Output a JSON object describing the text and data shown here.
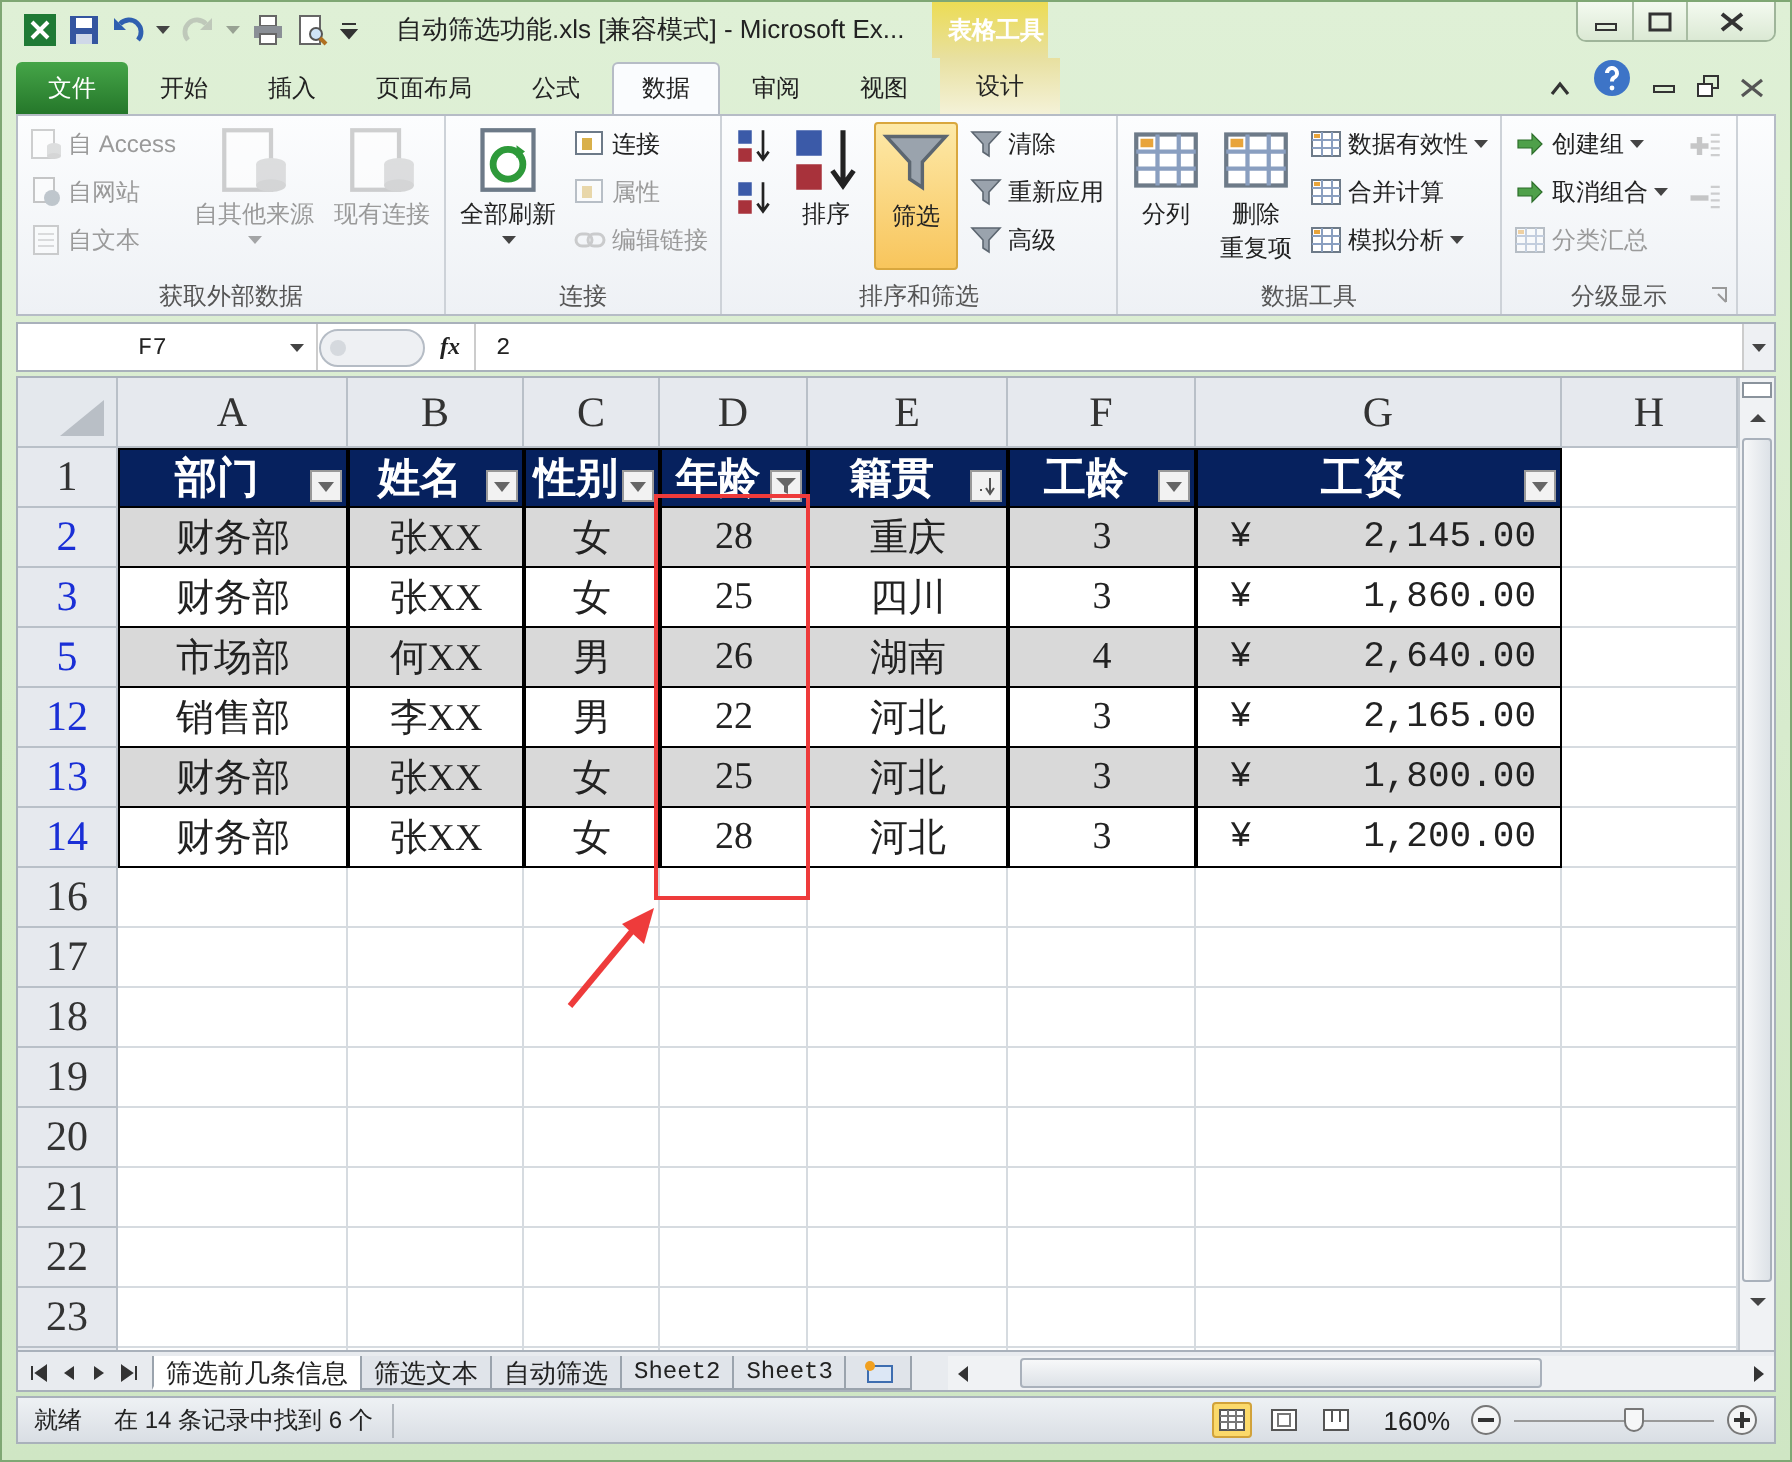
{
  "window": {
    "title": "自动筛选功能.xls  [兼容模式] - Microsoft Ex...",
    "context_group": "表格工具"
  },
  "ribbon_tabs": [
    {
      "label": "文件",
      "kind": "file",
      "selected": false
    },
    {
      "label": "开始",
      "kind": "normal",
      "selected": false
    },
    {
      "label": "插入",
      "kind": "normal",
      "selected": false
    },
    {
      "label": "页面布局",
      "kind": "normal",
      "selected": false
    },
    {
      "label": "公式",
      "kind": "normal",
      "selected": false
    },
    {
      "label": "数据",
      "kind": "normal",
      "selected": true
    },
    {
      "label": "审阅",
      "kind": "normal",
      "selected": false
    },
    {
      "label": "视图",
      "kind": "normal",
      "selected": false
    },
    {
      "label": "设计",
      "kind": "context",
      "selected": false
    }
  ],
  "ribbon": {
    "groups": [
      {
        "title": "获取外部数据",
        "columns": [
          {
            "items": [
              {
                "kind": "small",
                "label": "自 Access",
                "disabled": true,
                "dropdown": false,
                "on": false
              },
              {
                "kind": "small",
                "label": "自网站",
                "disabled": true,
                "dropdown": false,
                "on": false
              },
              {
                "kind": "small",
                "label": "自文本",
                "disabled": true,
                "dropdown": false,
                "on": false
              }
            ]
          },
          {
            "items": [
              {
                "kind": "large",
                "label": "自其他来源",
                "disabled": true,
                "dropdown": true,
                "on": false
              }
            ]
          },
          {
            "items": [
              {
                "kind": "large",
                "label": "现有连接",
                "disabled": true,
                "dropdown": false,
                "on": false
              }
            ]
          }
        ]
      },
      {
        "title": "连接",
        "columns": [
          {
            "items": [
              {
                "kind": "large",
                "label": "全部刷新",
                "disabled": false,
                "dropdown": true,
                "on": false
              }
            ]
          },
          {
            "items": [
              {
                "kind": "small",
                "label": "连接",
                "disabled": false,
                "dropdown": false,
                "on": false
              },
              {
                "kind": "small",
                "label": "属性",
                "disabled": true,
                "dropdown": false,
                "on": false
              },
              {
                "kind": "small",
                "label": "编辑链接",
                "disabled": true,
                "dropdown": false,
                "on": false
              }
            ]
          }
        ]
      },
      {
        "title": "排序和筛选",
        "columns": [
          {
            "items": [
              {
                "kind": "icon",
                "disabled": false,
                "dropdown": false,
                "on": false
              },
              {
                "kind": "icon",
                "disabled": false,
                "dropdown": false,
                "on": false
              }
            ]
          },
          {
            "items": [
              {
                "kind": "large",
                "label": "排序",
                "disabled": false,
                "dropdown": false,
                "on": false
              }
            ]
          },
          {
            "items": [
              {
                "kind": "large",
                "label": "筛选",
                "disabled": false,
                "dropdown": false,
                "on": true
              }
            ]
          },
          {
            "items": [
              {
                "kind": "small",
                "label": "清除",
                "disabled": false,
                "dropdown": false,
                "on": false
              },
              {
                "kind": "small",
                "label": "重新应用",
                "disabled": false,
                "dropdown": false,
                "on": false
              },
              {
                "kind": "small",
                "label": "高级",
                "disabled": false,
                "dropdown": false,
                "on": false
              }
            ]
          }
        ]
      },
      {
        "title": "数据工具",
        "columns": [
          {
            "items": [
              {
                "kind": "large",
                "label": "分列",
                "disabled": false,
                "dropdown": false,
                "on": false
              }
            ]
          },
          {
            "items": [
              {
                "kind": "large",
                "label": "删除",
                "label_2": "重复项",
                "disabled": false,
                "dropdown": false,
                "on": false
              }
            ]
          },
          {
            "items": [
              {
                "kind": "small",
                "label": "数据有效性",
                "disabled": false,
                "dropdown": true,
                "on": false
              },
              {
                "kind": "small",
                "label": "合并计算",
                "disabled": false,
                "dropdown": false,
                "on": false
              },
              {
                "kind": "small",
                "label": "模拟分析",
                "disabled": false,
                "dropdown": true,
                "on": false
              }
            ]
          }
        ]
      },
      {
        "title": "分级显示",
        "columns": [
          {
            "items": [
              {
                "kind": "small",
                "label": "创建组",
                "disabled": false,
                "dropdown": true,
                "on": false
              },
              {
                "kind": "small",
                "label": "取消组合",
                "disabled": false,
                "dropdown": true,
                "on": false
              },
              {
                "kind": "small",
                "label": "分类汇总",
                "disabled": true,
                "dropdown": false,
                "on": false
              }
            ]
          },
          {
            "items": [
              {
                "kind": "icon",
                "disabled": true,
                "dropdown": false,
                "on": false
              },
              {
                "kind": "icon",
                "disabled": true,
                "dropdown": false,
                "on": false
              }
            ]
          }
        ]
      }
    ]
  },
  "formula_bar": {
    "name_box": "F7",
    "function_button": "fx",
    "value": "2"
  },
  "columns": [
    "A",
    "B",
    "C",
    "D",
    "E",
    "F",
    "G",
    "H"
  ],
  "header_row": {
    "number": "1",
    "cells": [
      {
        "label": "部门",
        "filtered": false,
        "sorted": false
      },
      {
        "label": "姓名",
        "filtered": false,
        "sorted": false
      },
      {
        "label": "性别",
        "filtered": false,
        "sorted": false
      },
      {
        "label": "年龄",
        "filtered": true,
        "sorted": false
      },
      {
        "label": "籍贯",
        "filtered": false,
        "sorted": true
      },
      {
        "label": "工龄",
        "filtered": false,
        "sorted": false
      },
      {
        "label": "工资",
        "filtered": false,
        "sorted": false
      }
    ]
  },
  "rows": [
    {
      "number": "2",
      "filtered": true,
      "shaded": true,
      "cells": [
        "财务部",
        "张XX",
        "女",
        "28",
        "重庆",
        "3"
      ],
      "currency": "¥",
      "amount": "2,145.00"
    },
    {
      "number": "3",
      "filtered": true,
      "shaded": false,
      "cells": [
        "财务部",
        "张XX",
        "女",
        "25",
        "四川",
        "3"
      ],
      "currency": "¥",
      "amount": "1,860.00"
    },
    {
      "number": "5",
      "filtered": true,
      "shaded": true,
      "cells": [
        "市场部",
        "何XX",
        "男",
        "26",
        "湖南",
        "4"
      ],
      "currency": "¥",
      "amount": "2,640.00"
    },
    {
      "number": "12",
      "filtered": true,
      "shaded": false,
      "cells": [
        "销售部",
        "李XX",
        "男",
        "22",
        "河北",
        "3"
      ],
      "currency": "¥",
      "amount": "2,165.00"
    },
    {
      "number": "13",
      "filtered": true,
      "shaded": true,
      "cells": [
        "财务部",
        "张XX",
        "女",
        "25",
        "河北",
        "3"
      ],
      "currency": "¥",
      "amount": "1,800.00"
    },
    {
      "number": "14",
      "filtered": true,
      "shaded": false,
      "cells": [
        "财务部",
        "张XX",
        "女",
        "28",
        "河北",
        "3"
      ],
      "currency": "¥",
      "amount": "1,200.00"
    }
  ],
  "empty_rows": [
    "16",
    "17",
    "18",
    "19",
    "20",
    "21",
    "22",
    "23"
  ],
  "sheet_tabs": [
    {
      "label": "筛选前几条信息",
      "selected": true
    },
    {
      "label": "筛选文本",
      "selected": false
    },
    {
      "label": "自动筛选",
      "selected": false
    },
    {
      "label": "Sheet2",
      "selected": false
    },
    {
      "label": "Sheet3",
      "selected": false
    }
  ],
  "status_bar": {
    "ready": "就绪",
    "message": "在 14 条记录中找到 6 个",
    "views": [
      {
        "selected": true
      },
      {
        "selected": false
      },
      {
        "selected": false
      }
    ],
    "zoom": "160%",
    "zoom_slider": {
      "level": 0.6
    }
  }
}
